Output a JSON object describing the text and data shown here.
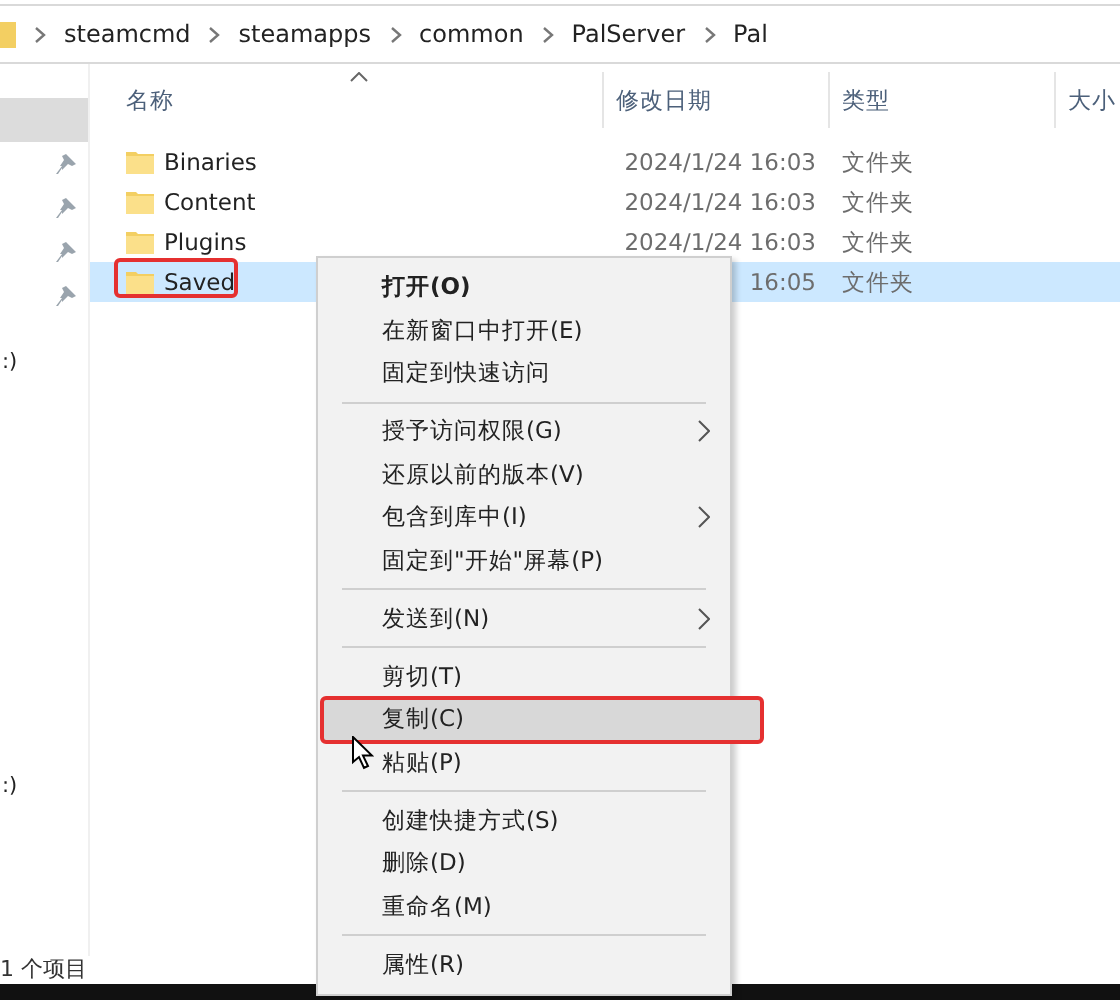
{
  "address_bar": {
    "crumbs": [
      "steamcmd",
      "steamapps",
      "common",
      "PalServer",
      "Pal"
    ]
  },
  "sidebar": {
    "items": [
      {
        "selected": true,
        "pinned": false
      },
      {
        "selected": false,
        "pinned": true
      },
      {
        "selected": false,
        "pinned": true
      },
      {
        "selected": false,
        "pinned": true
      },
      {
        "selected": false,
        "pinned": true
      },
      {
        "label": ":)",
        "selected": false,
        "pinned": false
      },
      {
        "label": ":)",
        "selected": false,
        "pinned": false
      }
    ]
  },
  "table": {
    "columns": [
      "名称",
      "修改日期",
      "类型",
      "大小"
    ],
    "rows": [
      {
        "name": "Binaries",
        "date": "2024/1/24 16:03",
        "type": "文件夹",
        "selected": false,
        "annotated": false
      },
      {
        "name": "Content",
        "date": "2024/1/24 16:03",
        "type": "文件夹",
        "selected": false,
        "annotated": false
      },
      {
        "name": "Plugins",
        "date": "2024/1/24 16:03",
        "type": "文件夹",
        "selected": false,
        "annotated": false
      },
      {
        "name": "Saved",
        "date": "16:05",
        "type": "文件夹",
        "selected": true,
        "annotated": true
      }
    ]
  },
  "status_bar": {
    "text": "1 个项目"
  },
  "context_menu": {
    "items": [
      {
        "kind": "item",
        "label": "打开(O)",
        "bold": true,
        "submenu": false,
        "selected": false,
        "annotated": false
      },
      {
        "kind": "item",
        "label": "在新窗口中打开(E)",
        "bold": false,
        "submenu": false,
        "selected": false,
        "annotated": false
      },
      {
        "kind": "item",
        "label": "固定到快速访问",
        "bold": false,
        "submenu": false,
        "selected": false,
        "annotated": false
      },
      {
        "kind": "separator"
      },
      {
        "kind": "item",
        "label": "授予访问权限(G)",
        "bold": false,
        "submenu": true,
        "selected": false,
        "annotated": false
      },
      {
        "kind": "item",
        "label": "还原以前的版本(V)",
        "bold": false,
        "submenu": false,
        "selected": false,
        "annotated": false
      },
      {
        "kind": "item",
        "label": "包含到库中(I)",
        "bold": false,
        "submenu": true,
        "selected": false,
        "annotated": false
      },
      {
        "kind": "item",
        "label": "固定到\"开始\"屏幕(P)",
        "bold": false,
        "submenu": false,
        "selected": false,
        "annotated": false
      },
      {
        "kind": "separator"
      },
      {
        "kind": "item",
        "label": "发送到(N)",
        "bold": false,
        "submenu": true,
        "selected": false,
        "annotated": false
      },
      {
        "kind": "separator"
      },
      {
        "kind": "item",
        "label": "剪切(T)",
        "bold": false,
        "submenu": false,
        "selected": false,
        "annotated": false
      },
      {
        "kind": "item",
        "label": "复制(C)",
        "bold": false,
        "submenu": false,
        "selected": true,
        "annotated": true
      },
      {
        "kind": "item",
        "label": "粘贴(P)",
        "bold": false,
        "submenu": false,
        "selected": false,
        "annotated": false
      },
      {
        "kind": "separator"
      },
      {
        "kind": "item",
        "label": "创建快捷方式(S)",
        "bold": false,
        "submenu": false,
        "selected": false,
        "annotated": false
      },
      {
        "kind": "item",
        "label": "删除(D)",
        "bold": false,
        "submenu": false,
        "selected": false,
        "annotated": false
      },
      {
        "kind": "item",
        "label": "重命名(M)",
        "bold": false,
        "submenu": false,
        "selected": false,
        "annotated": false
      },
      {
        "kind": "separator"
      },
      {
        "kind": "item",
        "label": "属性(R)",
        "bold": false,
        "submenu": false,
        "selected": false,
        "annotated": false
      }
    ]
  }
}
